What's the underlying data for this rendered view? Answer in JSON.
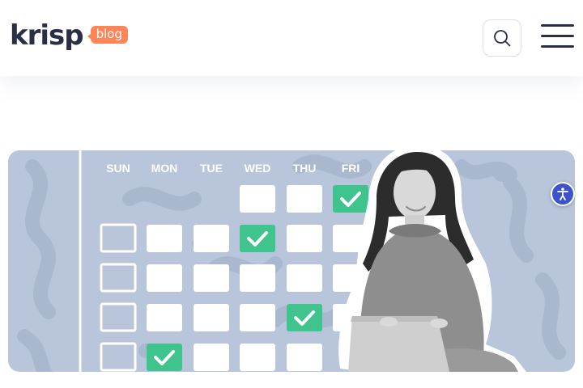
{
  "header": {
    "logo_text": "krisp",
    "logo_badge": "blog",
    "search_icon": "search-icon",
    "menu_icon": "hamburger-menu-icon"
  },
  "hero": {
    "day_labels": [
      "SUN",
      "MON",
      "TUE",
      "WED",
      "THU",
      "FRI"
    ],
    "illustration": "woman-with-laptop-and-weekly-checklist"
  },
  "accessibility": {
    "icon": "accessibility-icon"
  },
  "colors": {
    "brand_dark": "#2b2f45",
    "brand_orange": "#ff8559",
    "hero_background": "#b9c5da",
    "check_green": "#3ec48c",
    "accessibility_blue": "#3b54c9"
  }
}
